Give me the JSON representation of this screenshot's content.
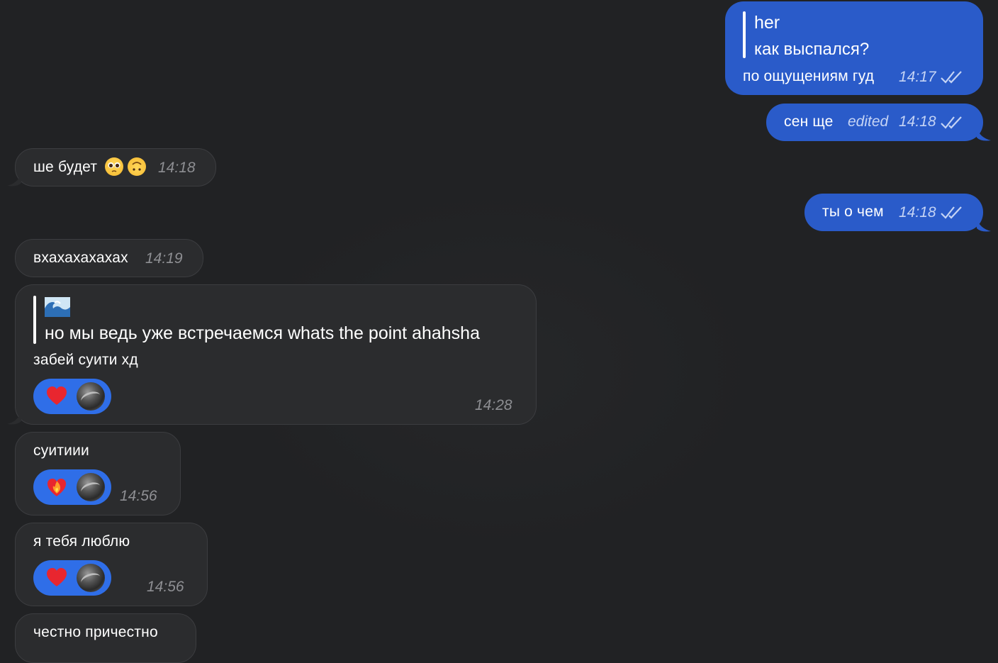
{
  "messages": {
    "m1": {
      "quote_name": "her",
      "quote_text": "как выспался?",
      "text": "по ощущениям гуд",
      "time": "14:17"
    },
    "m2": {
      "text": "сен ще",
      "edited": "edited",
      "time": "14:18"
    },
    "m3": {
      "text": "ше будет",
      "time": "14:18",
      "emojis": [
        "pleading-face",
        "upside-down-face"
      ]
    },
    "m4": {
      "text": "ты о чем",
      "time": "14:18"
    },
    "m5": {
      "text": "вхахахахахах",
      "time": "14:19"
    },
    "m6": {
      "quote_emoji": "water-wave",
      "quote_text": "но мы ведь уже встречаемся whats the point ahahsha",
      "text": "забей суити хд",
      "time": "14:28",
      "reaction": "red-heart"
    },
    "m7": {
      "text": "суитиии",
      "time": "14:56",
      "reaction": "heart-on-fire"
    },
    "m8": {
      "text": "я тебя люблю",
      "time": "14:56",
      "reaction": "red-heart"
    },
    "m9": {
      "text": "честно причестно"
    }
  },
  "colors": {
    "background": "#212224",
    "outgoing_bubble": "#2a5bc9",
    "incoming_bubble": "#2b2c2e",
    "reaction_pill": "#2f6ee8"
  },
  "icons": {
    "read_receipt": "double-check-icon"
  }
}
